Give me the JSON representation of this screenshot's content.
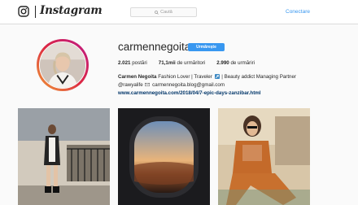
{
  "topbar": {
    "brand": "Instagram",
    "search_placeholder": "Caută",
    "login_label": "Conectare"
  },
  "profile": {
    "username": "carmennegoita",
    "follow_label": "Urmărește",
    "stats": {
      "posts_count": "2.021",
      "posts_label": "postări",
      "followers_count": "71,1mii",
      "followers_label": "de urmăritori",
      "following_count": "2.990",
      "following_label": "de urmăriri"
    },
    "bio": {
      "name": "Carmen Negoita",
      "line1_text": "Fashion Lover | Traveler",
      "line1_text2": "| Beauty addict Managing Partner",
      "line2_handle": "@rawyalife",
      "line2_blog": "carmennegoita.blog@gmail.com",
      "link": "www.carmennegoita.com/2018/04/7-epic-days-zanzibar.html"
    }
  },
  "posts": [
    {
      "icon": "street-photo"
    },
    {
      "icon": "airplane-window-photo"
    },
    {
      "icon": "orange-suit-photo"
    }
  ],
  "colors": {
    "accent": "#3897f0",
    "link": "#003569",
    "ring_start": "#f09433",
    "ring_end": "#bc1888"
  }
}
